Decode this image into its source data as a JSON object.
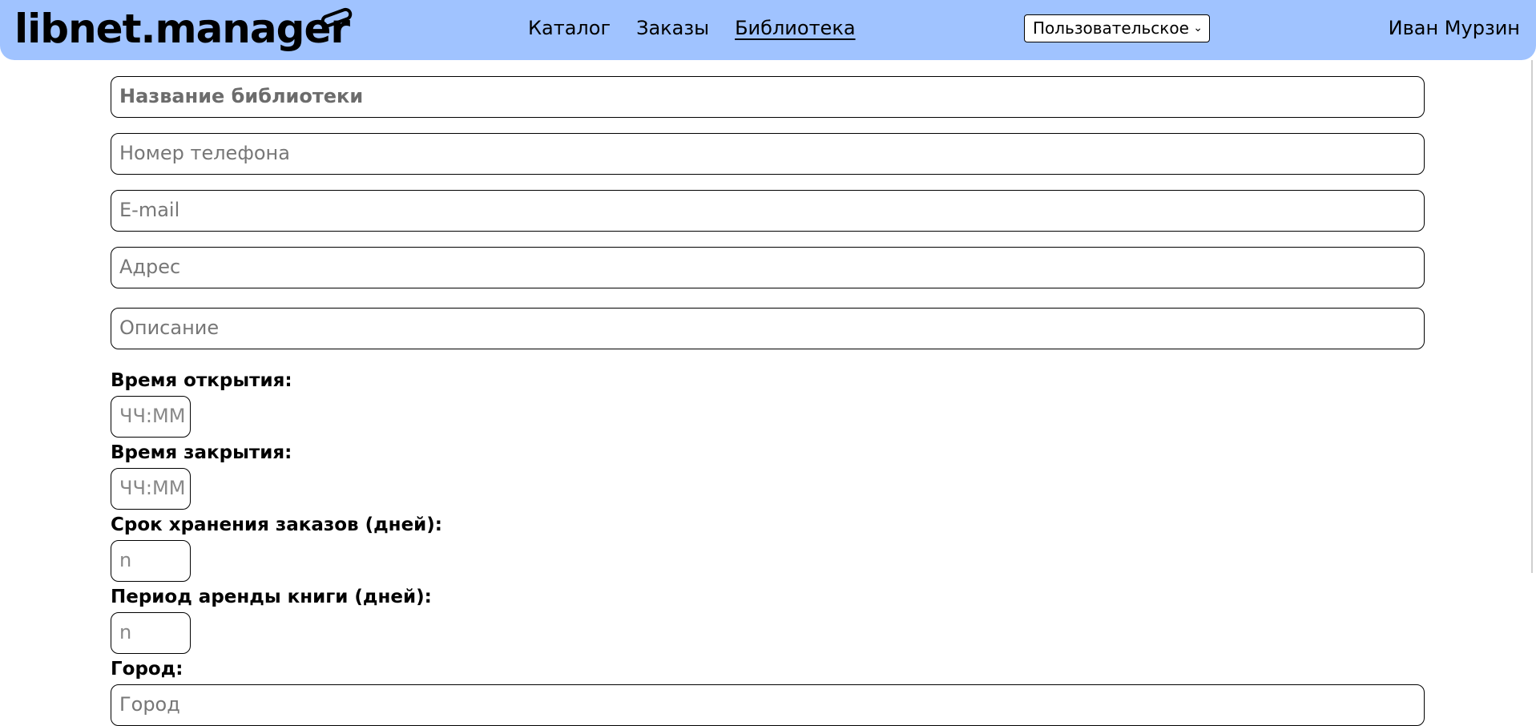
{
  "header": {
    "logo_text": "libnet.manager",
    "nav": [
      {
        "label": "Каталог"
      },
      {
        "label": "Заказы"
      },
      {
        "label": "Библиотека",
        "active": true
      }
    ],
    "mode_select": {
      "selected": "Пользовательское"
    },
    "user_name": "Иван Мурзин",
    "background_color": "#a0c3ff"
  },
  "form": {
    "library_name": {
      "placeholder": "Название библиотеки"
    },
    "phone": {
      "placeholder": "Номер телефона"
    },
    "email": {
      "placeholder": "E-mail"
    },
    "address": {
      "placeholder": "Адрес"
    },
    "description": {
      "placeholder": "Описание"
    },
    "opening_time": {
      "label": "Время открытия:",
      "placeholder": "ЧЧ:ММ"
    },
    "closing_time": {
      "label": "Время закрытия:",
      "placeholder": "ЧЧ:ММ"
    },
    "order_storage_days": {
      "label": "Срок хранения заказов (дней):",
      "placeholder": "n"
    },
    "rental_period_days": {
      "label": "Период аренды книги (дней):",
      "placeholder": "n"
    },
    "city": {
      "label": "Город:",
      "placeholder": "Город"
    }
  }
}
